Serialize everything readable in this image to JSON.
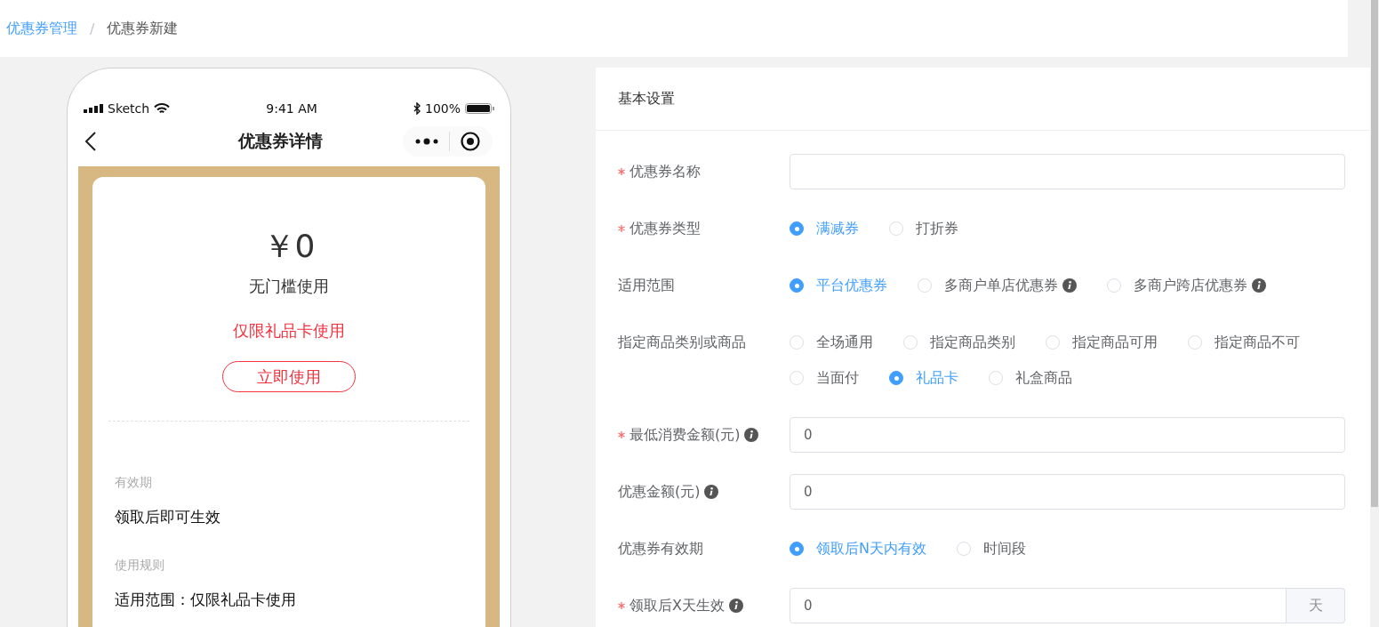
{
  "breadcrumb": {
    "items": [
      {
        "label": "优惠券管理",
        "link": true
      },
      {
        "label": "优惠券新建",
        "link": false
      }
    ],
    "separator": "/"
  },
  "phone": {
    "carrier": "Sketch",
    "time": "9:41 AM",
    "battery": "100%",
    "title": "优惠券详情",
    "coupon": {
      "amount": "￥0",
      "threshold": "无门槛使用",
      "restriction": "仅限礼品卡使用",
      "button": "立即使用",
      "sections": [
        {
          "heading": "有效期",
          "text": "领取后即可生效"
        },
        {
          "heading": "使用规则",
          "text": "适用范围：仅限礼品卡使用"
        }
      ]
    }
  },
  "form": {
    "title": "基本设置",
    "fields": [
      {
        "kind": "input",
        "label": "优惠券名称",
        "required": true,
        "info": false
      },
      {
        "kind": "radio",
        "label": "优惠券类型",
        "required": true,
        "info": false,
        "options": [
          {
            "label": "满减券",
            "selected": true,
            "info": false
          },
          {
            "label": "打折券",
            "selected": false,
            "info": false
          }
        ]
      },
      {
        "kind": "radio",
        "label": "适用范围",
        "required": false,
        "info": false,
        "options": [
          {
            "label": "平台优惠券",
            "selected": true,
            "info": false
          },
          {
            "label": "多商户单店优惠券",
            "selected": false,
            "info": true
          },
          {
            "label": "多商户跨店优惠券",
            "selected": false,
            "info": true
          }
        ]
      },
      {
        "kind": "radio",
        "label": "指定商品类别或商品",
        "required": false,
        "info": false,
        "options": [
          {
            "label": "全场通用",
            "selected": false,
            "info": false
          },
          {
            "label": "指定商品类别",
            "selected": false,
            "info": false
          },
          {
            "label": "指定商品可用",
            "selected": false,
            "info": false
          },
          {
            "label": "指定商品不可",
            "selected": false,
            "info": false
          },
          {
            "label": "当面付",
            "selected": false,
            "info": false
          },
          {
            "label": "礼品卡",
            "selected": true,
            "info": false
          },
          {
            "label": "礼盒商品",
            "selected": false,
            "info": false
          }
        ]
      },
      {
        "kind": "input",
        "label": "最低消费金额(元)",
        "required": true,
        "info": true,
        "value": "0"
      },
      {
        "kind": "input",
        "label": "优惠金额(元)",
        "required": false,
        "info": true,
        "value": "0"
      },
      {
        "kind": "radio",
        "label": "优惠券有效期",
        "required": false,
        "info": false,
        "options": [
          {
            "label": "领取后N天内有效",
            "selected": true,
            "info": false
          },
          {
            "label": "时间段",
            "selected": false,
            "info": false
          }
        ]
      },
      {
        "kind": "input",
        "label": "领取后X天生效",
        "required": true,
        "info": true,
        "value": "0",
        "suffix": "天"
      }
    ]
  }
}
